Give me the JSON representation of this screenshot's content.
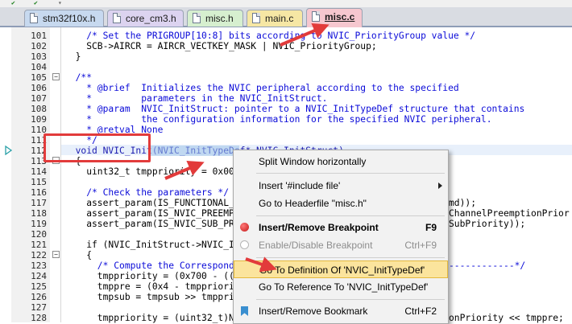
{
  "tabs": [
    {
      "label": "stm32f10x.h",
      "color": "#c7d9ef",
      "active": false
    },
    {
      "label": "core_cm3.h",
      "color": "#dcd3f0",
      "active": false
    },
    {
      "label": "misc.h",
      "color": "#d6efcf",
      "active": false
    },
    {
      "label": "main.c",
      "color": "#f6e7a4",
      "active": false
    },
    {
      "label": "misc.c",
      "color": "#f6c7cf",
      "active": true
    }
  ],
  "editor": {
    "lines": [
      {
        "num": "101",
        "text": "    /* Set the PRIGROUP[10:8] bits according to NVIC_PriorityGroup value */"
      },
      {
        "num": "102",
        "text": "    SCB->AIRCR = AIRCR_VECTKEY_MASK | NVIC_PriorityGroup;"
      },
      {
        "num": "103",
        "text": "  }"
      },
      {
        "num": "104",
        "text": ""
      },
      {
        "num": "105",
        "text": "  /**"
      },
      {
        "num": "106",
        "text": "    * @brief  Initializes the NVIC peripheral according to the specified"
      },
      {
        "num": "107",
        "text": "    *         parameters in the NVIC_InitStruct."
      },
      {
        "num": "108",
        "text": "    * @param  NVIC_InitStruct: pointer to a NVIC_InitTypeDef structure that contains"
      },
      {
        "num": "109",
        "text": "    *         the configuration information for the specified NVIC peripheral."
      },
      {
        "num": "110",
        "text": "    * @retval None"
      },
      {
        "num": "111",
        "text": "    */"
      },
      {
        "num": "112",
        "text": "  void NVIC_Init(NVIC_InitTypeDef* NVIC_InitStruct)"
      },
      {
        "num": "113",
        "text": "  {"
      },
      {
        "num": "114",
        "text": "    uint32_t tmppriority = 0x00,"
      },
      {
        "num": "115",
        "text": ""
      },
      {
        "num": "116",
        "text": "    /* Check the parameters */"
      },
      {
        "num": "117",
        "text": "    assert_param(IS_FUNCTIONAL_S"
      },
      {
        "num": "118",
        "text": "    assert_param(IS_NVIC_PREEMPT"
      },
      {
        "num": "119",
        "text": "    assert_param(IS_NVIC_SUB_PRI"
      },
      {
        "num": "120",
        "text": ""
      },
      {
        "num": "121",
        "text": "    if (NVIC_InitStruct->NVIC_IR"
      },
      {
        "num": "122",
        "text": "    {"
      },
      {
        "num": "123",
        "text": "      /* Compute the Correspondi"
      },
      {
        "num": "124",
        "text": "      tmppriority = (0x700 - ((S"
      },
      {
        "num": "125",
        "text": "      tmppre = (0x4 - tmppriorit"
      },
      {
        "num": "126",
        "text": "      tmpsub = tmpsub >> tmppric"
      },
      {
        "num": "127",
        "text": ""
      },
      {
        "num": "128",
        "text": "      tmppriority = (uint32_t)NV"
      }
    ],
    "right_fragments": {
      "r117": "md));",
      "r118": "ChannelPreemptionPrior",
      "r119": "SubPriority));",
      "r123": "------------*/",
      "r128": "onPriority << tmppre;"
    }
  },
  "context_menu": {
    "items": [
      {
        "label": "Split Window horizontally",
        "shortcut": ""
      },
      {
        "label": "Insert '#include file'",
        "shortcut": ""
      },
      {
        "label": "Go to Headerfile \"misc.h\"",
        "shortcut": ""
      },
      {
        "label": "Insert/Remove Breakpoint",
        "shortcut": "F9"
      },
      {
        "label": "Enable/Disable Breakpoint",
        "shortcut": "Ctrl+F9"
      },
      {
        "label": "Go To Definition Of 'NVIC_InitTypeDef'",
        "shortcut": ""
      },
      {
        "label": "Go To Reference To 'NVIC_InitTypeDef'",
        "shortcut": ""
      },
      {
        "label": "Insert/Remove Bookmark",
        "shortcut": "Ctrl+F2"
      }
    ]
  },
  "icons": [
    "green-check-icon",
    "file-icon",
    "breakpoint-icon",
    "bookmark-icon",
    "submenu-arrow-icon",
    "execution-arrow-icon"
  ],
  "colors": {
    "annotation_red": "#e23b3b",
    "menu_highlight": "#fbe49d",
    "selection": "#9fc4ea"
  }
}
